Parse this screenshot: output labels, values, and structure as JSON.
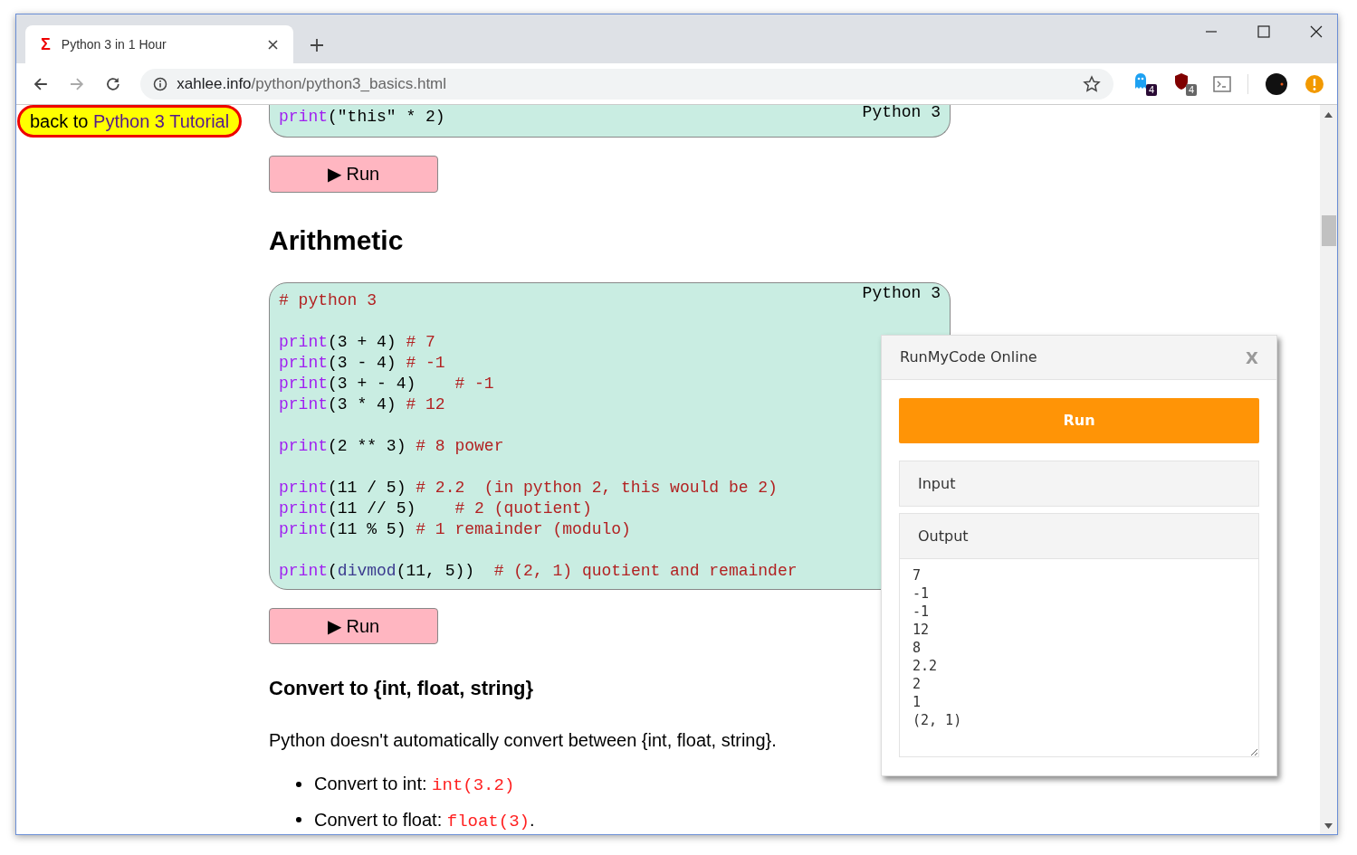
{
  "browser": {
    "tab": {
      "favicon": "Σ",
      "title": "Python 3 in 1 Hour",
      "selected": true
    },
    "url": {
      "host": "xahlee.info",
      "path": "/python/python3_basics.html"
    },
    "extension_badges": [
      "4",
      "4"
    ]
  },
  "back_link": {
    "prefix": "back to",
    "link": "Python 3 Tutorial"
  },
  "sections": [
    {
      "kind": "code",
      "label": "Python 3",
      "cut_top": true,
      "blocks": [
        [
          [
            {
              "kind": "func",
              "text": "print"
            },
            {
              "kind": "plain",
              "text": "(\"this\" * 2)"
            }
          ]
        ]
      ]
    },
    {
      "kind": "button",
      "label": "▶ Run"
    },
    {
      "kind": "h2",
      "text": "Arithmetic"
    },
    {
      "kind": "code",
      "label": "Python 3",
      "cut_top": false,
      "blocks": [
        [
          [
            {
              "kind": "comment",
              "text": "# python 3"
            }
          ]
        ],
        [
          [
            {
              "kind": "func",
              "text": "print"
            },
            {
              "kind": "plain",
              "text": "(3 + 4) "
            },
            {
              "kind": "comment",
              "text": "# 7"
            }
          ],
          [
            {
              "kind": "func",
              "text": "print"
            },
            {
              "kind": "plain",
              "text": "(3 - 4) "
            },
            {
              "kind": "comment",
              "text": "# -1"
            }
          ],
          [
            {
              "kind": "func",
              "text": "print"
            },
            {
              "kind": "plain",
              "text": "(3 + - 4)    "
            },
            {
              "kind": "comment",
              "text": "# -1"
            }
          ],
          [
            {
              "kind": "func",
              "text": "print"
            },
            {
              "kind": "plain",
              "text": "(3 * 4) "
            },
            {
              "kind": "comment",
              "text": "# 12"
            }
          ]
        ],
        [
          [
            {
              "kind": "func",
              "text": "print"
            },
            {
              "kind": "plain",
              "text": "(2 ** 3) "
            },
            {
              "kind": "comment",
              "text": "# 8 power"
            }
          ]
        ],
        [
          [
            {
              "kind": "func",
              "text": "print"
            },
            {
              "kind": "plain",
              "text": "(11 / 5) "
            },
            {
              "kind": "comment",
              "text": "# 2.2  (in python 2, this would be 2)"
            }
          ],
          [
            {
              "kind": "func",
              "text": "print"
            },
            {
              "kind": "plain",
              "text": "(11 // 5)    "
            },
            {
              "kind": "comment",
              "text": "# 2 (quotient)"
            }
          ],
          [
            {
              "kind": "func",
              "text": "print"
            },
            {
              "kind": "plain",
              "text": "(11 % 5) "
            },
            {
              "kind": "comment",
              "text": "# 1 remainder (modulo)"
            }
          ]
        ],
        [
          [
            {
              "kind": "func",
              "text": "print"
            },
            {
              "kind": "plain",
              "text": "("
            },
            {
              "kind": "builtin",
              "text": "divmod"
            },
            {
              "kind": "plain",
              "text": "(11, 5))  "
            },
            {
              "kind": "comment",
              "text": "# (2, 1) quotient and remainder"
            }
          ]
        ]
      ]
    },
    {
      "kind": "button",
      "label": "▶ Run"
    },
    {
      "kind": "h3",
      "text": "Convert to {int, float, string}"
    },
    {
      "kind": "p",
      "text": "Python doesn't automatically convert between {int, float, string}."
    },
    {
      "kind": "list",
      "items": [
        {
          "text": "Convert to int:",
          "code": "int(3.2)"
        },
        {
          "text": "Convert to float:",
          "code": "float(3)",
          "after": "."
        }
      ]
    }
  ],
  "popup": {
    "title": "RunMyCode Online",
    "close": "X",
    "run": "Run",
    "input": "Input",
    "output": "Output",
    "output_text": "7\n-1\n-1\n12\n8\n2.2\n2\n1\n(2, 1)"
  }
}
